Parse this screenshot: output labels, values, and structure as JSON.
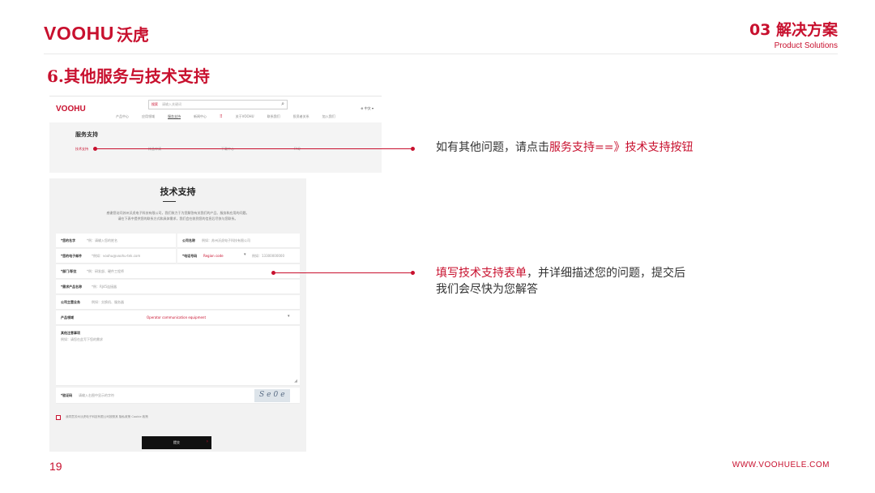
{
  "header": {
    "logo_en": "VOOHU",
    "logo_cn": "沃虎",
    "section_title": "03 解决方案",
    "section_subtitle": "Product Solutions"
  },
  "page_title": "6.其他服务与技术支持",
  "website": {
    "logo": "VOOHU",
    "search_category": "搜索",
    "search_placeholder": "请输入关键词",
    "lang": "中文",
    "nav_items": [
      "产品中心",
      "应用领域",
      "服务支持",
      "新闻中心",
      "关于VOOHU",
      "联系我们",
      "投资者关系",
      "加入我们"
    ],
    "nav_selected_index": 2,
    "heading": "服务支持",
    "tabs": [
      "技术支持",
      "样品申请",
      "下载中心",
      "FAQ"
    ]
  },
  "form": {
    "title": "技术支持",
    "intro_line1": "感谢您访问苏州沃虎电子科技有限公司，我们致力于为您解答有关我们的产品、服务和应用的问题。",
    "intro_line2": "请在下表中提供您的联系方式和具体需求，我们会在收到您的信息后尽快与您联系。",
    "name_label": "*您的名字",
    "name_placeholder": "*例：请输入您的姓名",
    "company_label": "公司名称",
    "company_placeholder": "例如：苏州沃虎电子科技有限公司",
    "email_label": "*您的电子邮件",
    "email_placeholder": "*例如：voohu@voohu-tek.com",
    "phone_label": "*电话号码",
    "phone_code": "Region code",
    "phone_placeholder": "例如：13300000000",
    "dept_label": "*部门/职位",
    "dept_placeholder": "*例：研发部、硬件工程师",
    "product_label": "*需求产品名称",
    "product_placeholder": "*例：RJ45连接器",
    "main_product_label": "公司主营业务",
    "main_product_placeholder": "例如：交换机、服务器",
    "category_label": "产品领域",
    "category_value": "Operator communication equipment",
    "notes_label": "其他注意事项",
    "notes_placeholder": "例如：请您在此写下您的需求",
    "captcha_label": "*验证码",
    "captcha_placeholder": "请输入右图中显示的字符",
    "captcha_text": "Se0e",
    "consent_text": "我同意苏州沃虎电子科技有限公司按照其 隐私政策 Cookie 政策",
    "submit_label": "提交"
  },
  "annotations": {
    "a1_prefix": "如有其他问题，请点击",
    "a1_highlight": "服务支持==》技术支持按钮",
    "a2_highlight": "填写技术支持表单",
    "a2_rest": "，并详细描述您的问题，提交后",
    "a2_line2": "我们会尽快为您解答"
  },
  "footer": {
    "page_number": "19",
    "website": "WWW.VOOHUELE.COM"
  },
  "colors": {
    "accent": "#c8102e"
  }
}
